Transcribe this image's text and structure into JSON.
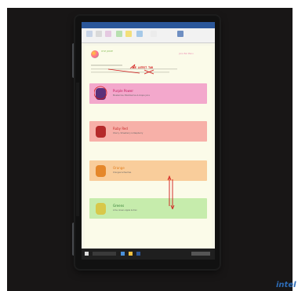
{
  "document": {
    "brand": "XYZ JUICE",
    "header": "Juice Bar Menu",
    "annotation": "USE LATEST TAB",
    "sections": [
      {
        "title": "Purple Power",
        "subtitle": "Blueberries, Blackberries & Grape juice",
        "color": "#f3a8cc",
        "title_color": "#c2185b",
        "fruit": "#5a2f7a"
      },
      {
        "title": "Ruby Red",
        "subtitle": "Cherry, Strawberry & Raspberry",
        "color": "#f7b0a8",
        "title_color": "#c62828",
        "fruit": "#b52a2a"
      },
      {
        "title": "Orange",
        "subtitle": "Oranges & Peaches",
        "color": "#f9cd9b",
        "title_color": "#e07b1a",
        "fruit": "#e5872a"
      },
      {
        "title": "Greens",
        "subtitle": "Lime, Green Apple & Kiwi",
        "color": "#c6ecac",
        "title_color": "#2e7d32",
        "fruit": "#d8c84a"
      }
    ]
  },
  "colors": {
    "ribbon": "#2b579a",
    "annotation": "#d21818"
  },
  "logo_text": "intel"
}
